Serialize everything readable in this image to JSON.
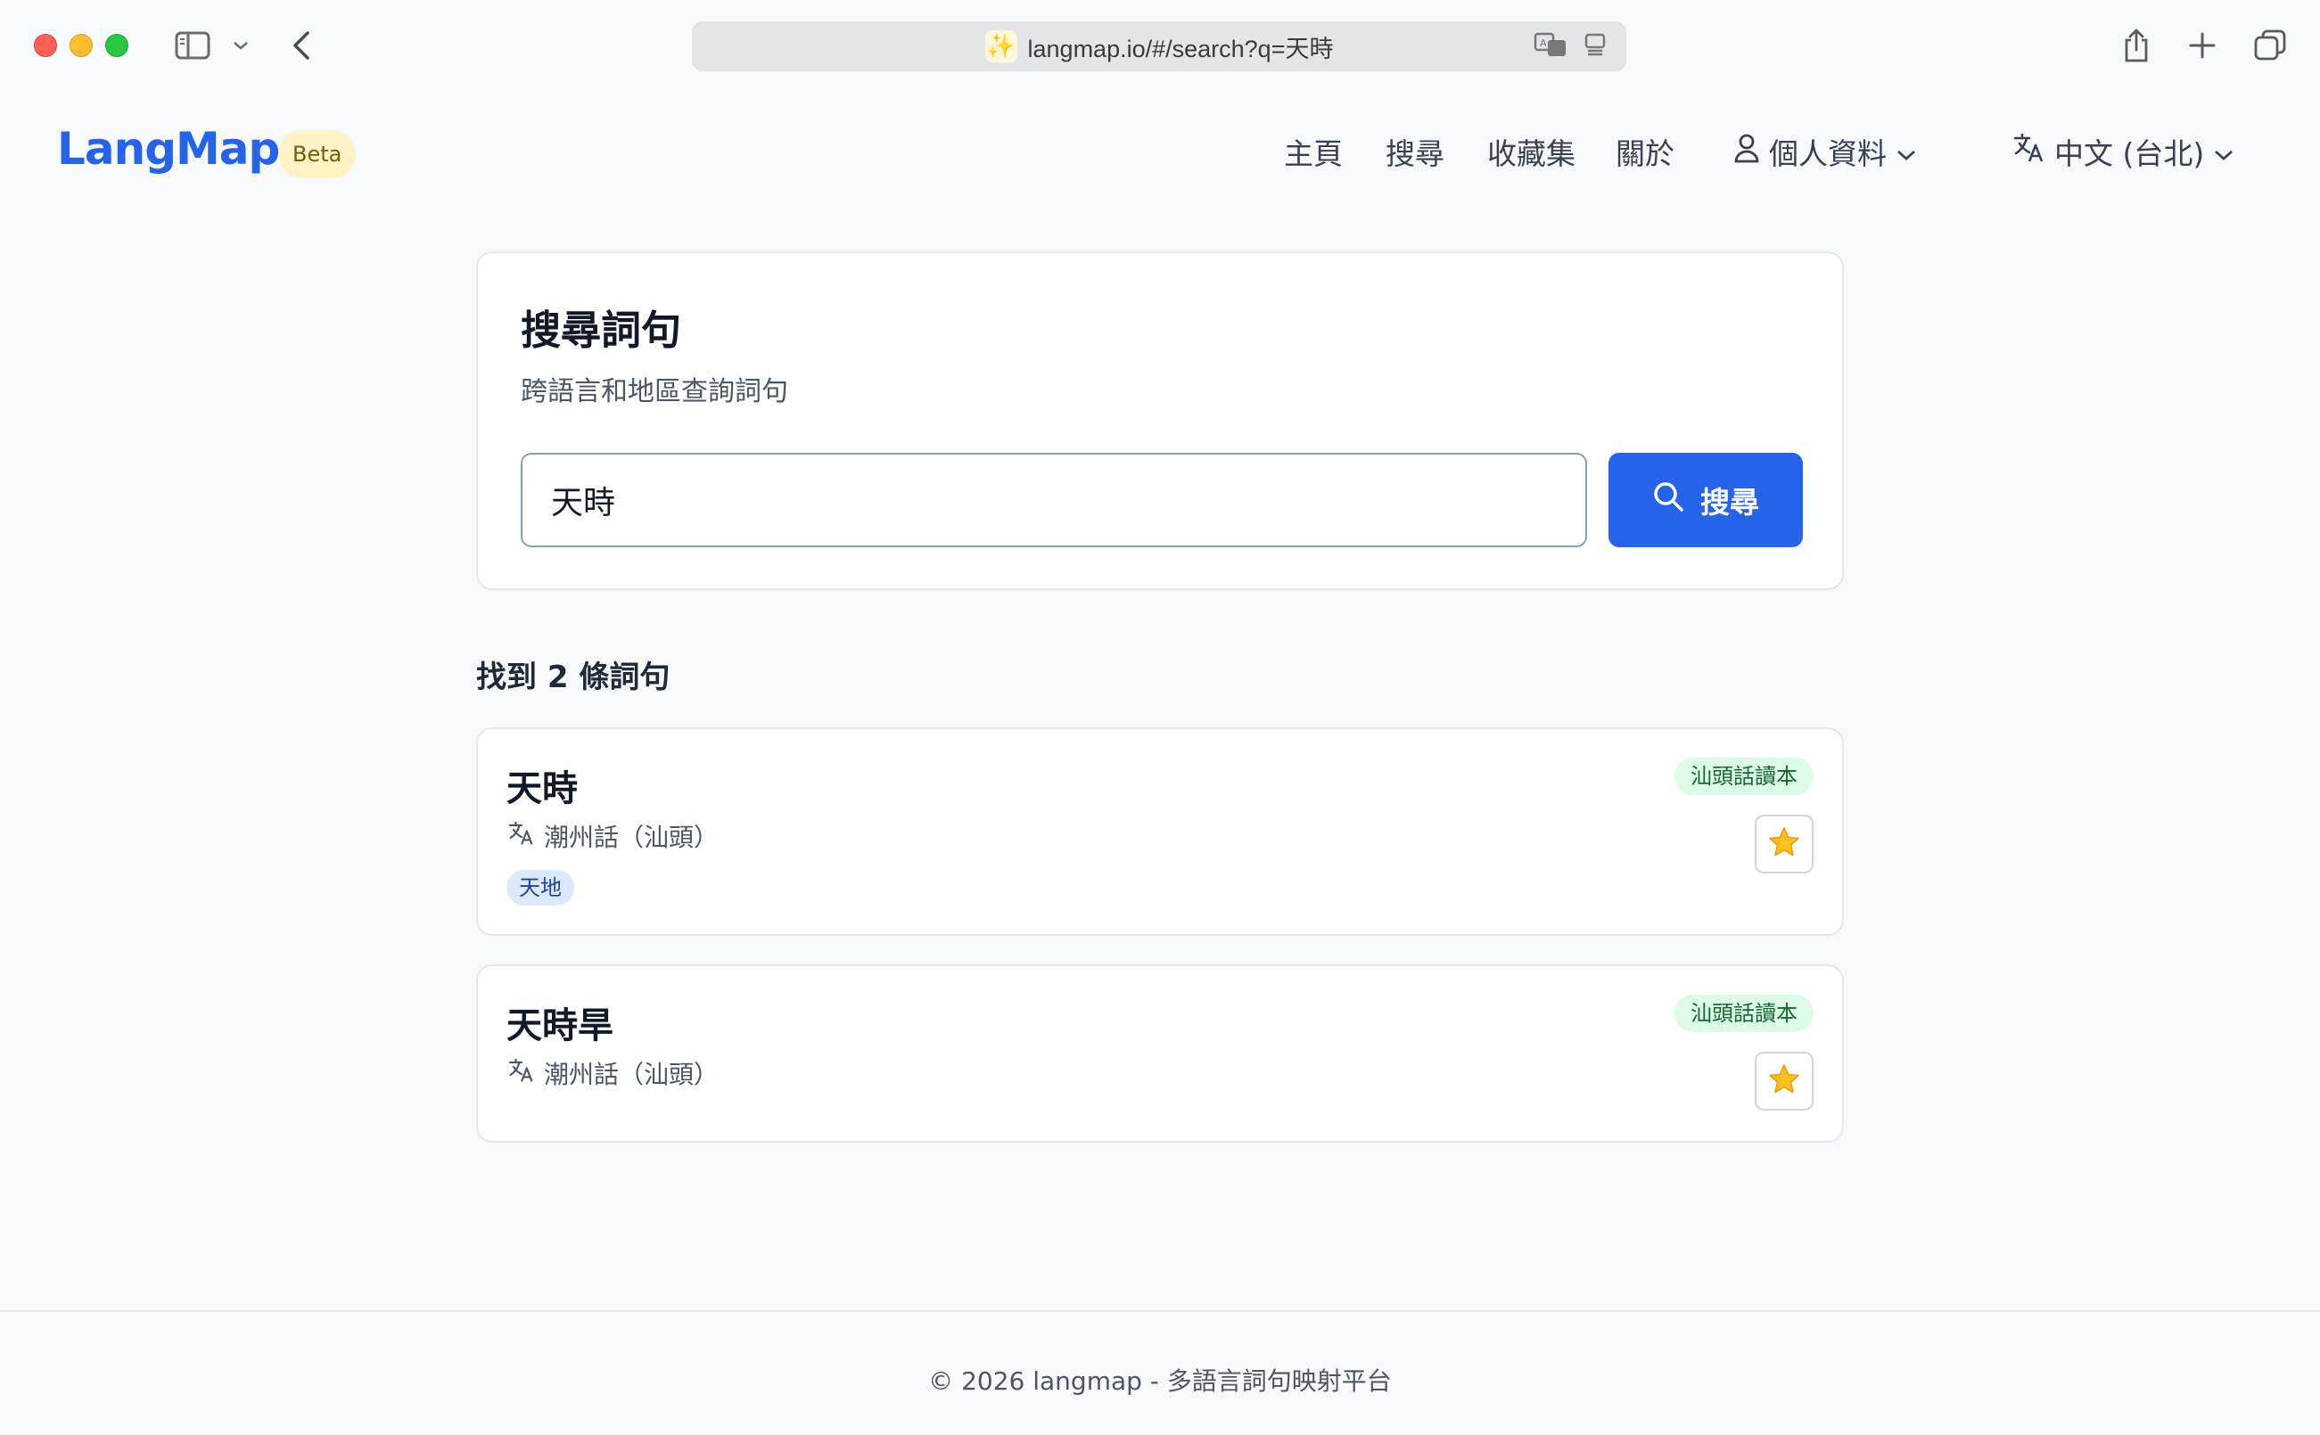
{
  "browser": {
    "url": "langmap.io/#/search?q=天時",
    "favicon": "sparkles-icon"
  },
  "header": {
    "logo": "LangMap",
    "badge": "Beta",
    "nav": {
      "home": "主頁",
      "search": "搜尋",
      "collections": "收藏集",
      "about": "關於",
      "profile": "個人資料",
      "language": "中文 (台北)"
    }
  },
  "search": {
    "title": "搜尋詞句",
    "subtitle": "跨語言和地區查詢詞句",
    "query": "天時",
    "button_label": "搜尋"
  },
  "results": {
    "count_text": "找到 2 條詞句",
    "items": [
      {
        "phrase": "天時",
        "language": "潮州話（汕頭）",
        "source": "汕頭話讀本",
        "category": "天地"
      },
      {
        "phrase": "天時旱",
        "language": "潮州話（汕頭）",
        "source": "汕頭話讀本"
      }
    ]
  },
  "footer": {
    "text": "© 2026 langmap - 多語言詞句映射平台"
  },
  "colors": {
    "brand": "#2563eb",
    "beta_bg": "#fdf3c4",
    "source_badge_bg": "#dcfce7",
    "category_bg": "#dbeafe"
  }
}
